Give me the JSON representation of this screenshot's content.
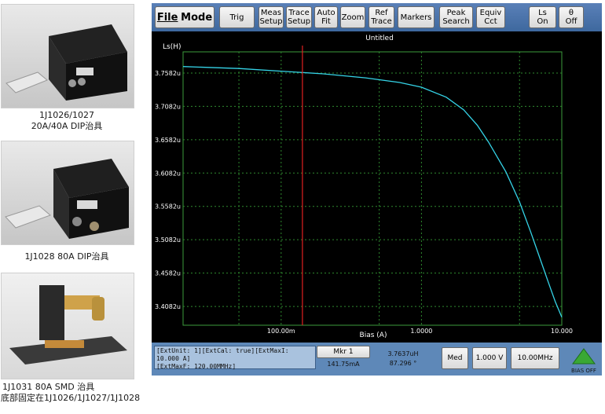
{
  "products": [
    {
      "caption_line1": "1J1026/1027",
      "caption_line2": "20A/40A DIP治具"
    },
    {
      "caption_line1": "1J1028  80A  DIP治具",
      "caption_line2": ""
    },
    {
      "caption_line1": "1J1031 80A  SMD 治具",
      "caption_line2": "底部固定在1J1026/1J1027/1J1028"
    }
  ],
  "toolbar": {
    "file": "File",
    "mode": "Mode",
    "buttons": [
      "Trig",
      "Meas\nSetup",
      "Trace\nSetup",
      "Auto\nFit",
      "Zoom",
      "Ref\nTrace",
      "Markers",
      "Peak\nSearch",
      "Equiv\nCct",
      "Ls\nOn",
      "θ\nOff"
    ]
  },
  "chart_data": {
    "type": "line",
    "title": "Untitled",
    "ylabel": "Ls(H)",
    "xlabel": "Bias (A)",
    "x_scale": "log",
    "xlim": [
      0.02,
      10
    ],
    "ylim": [
      3.38,
      3.79
    ],
    "y_ticks": [
      "3.7582u",
      "3.7082u",
      "3.6582u",
      "3.6082u",
      "3.5582u",
      "3.5082u",
      "3.4582u",
      "3.4082u"
    ],
    "y_tick_values": [
      3.7582,
      3.7082,
      3.6582,
      3.6082,
      3.5582,
      3.5082,
      3.4582,
      3.4082
    ],
    "x_ticks": [
      "100.00m",
      "1.0000",
      "10.000"
    ],
    "x_tick_values": [
      0.1,
      1,
      10
    ],
    "grid": true,
    "marker_x": 0.1418,
    "series": [
      {
        "color": "#35d4e8",
        "x": [
          0.02,
          0.05,
          0.1,
          0.2,
          0.4,
          0.7,
          1.0,
          1.5,
          2.0,
          2.5,
          3.0,
          4.0,
          5.0,
          6.0,
          7.0,
          8.0,
          9.0,
          10.0
        ],
        "y": [
          3.768,
          3.765,
          3.761,
          3.757,
          3.751,
          3.744,
          3.737,
          3.722,
          3.703,
          3.68,
          3.655,
          3.61,
          3.565,
          3.52,
          3.48,
          3.445,
          3.415,
          3.392
        ]
      }
    ]
  },
  "status": {
    "info_line1": "[ExtUnit: 1][ExtCal: true][ExtMaxI:  10.000 A]",
    "info_line2": "[ExtMaxF:  120.00MMHz]",
    "marker_button": "Mkr 1",
    "marker_x": "141.75mA",
    "marker_value": "3.7637uH",
    "marker_angle": "87.296 °",
    "speed": "Med",
    "level": "1.000 V",
    "frequency": "10.00MHz",
    "bias_label": "BIAS OFF",
    "bias_color": "#3aa835"
  }
}
